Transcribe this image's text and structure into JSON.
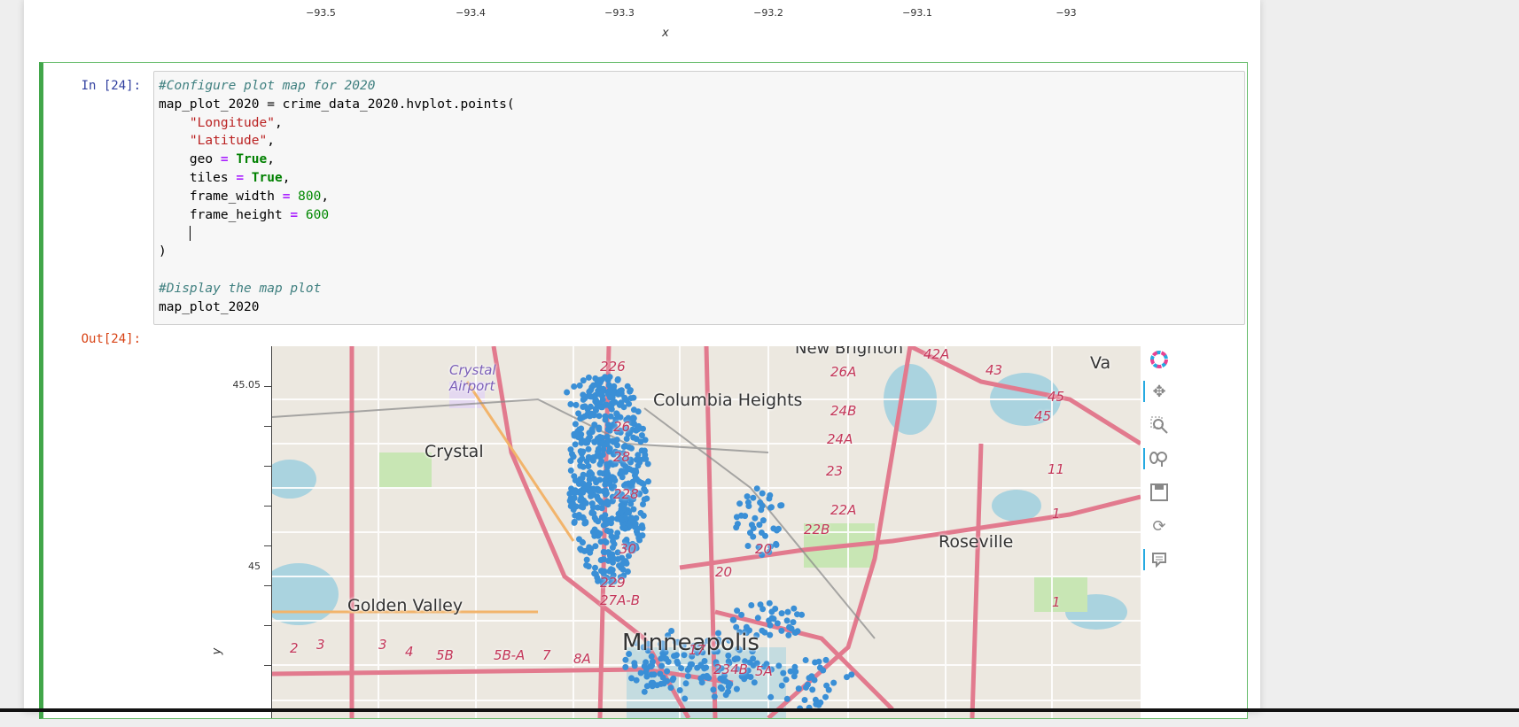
{
  "previous_output": {
    "x_ticks": [
      "−93.5",
      "−93.4",
      "−93.3",
      "−93.2",
      "−93.1",
      "−93"
    ],
    "x_label": "x"
  },
  "cell": {
    "in_prompt": "In [24]:",
    "out_prompt": "Out[24]:",
    "code_lines": {
      "l1_comment": "#Configure plot map for 2020",
      "l2_a": "map_plot_2020 = crime_data_2020.hvplot.points(",
      "l3_str": "\"Longitude\"",
      "l4_str": "\"Latitude\"",
      "l5_name": "geo",
      "l5_val": "True",
      "l6_name": "tiles",
      "l6_val": "True",
      "l7_name": "frame_width",
      "l7_val": "800",
      "l8_name": "frame_height",
      "l8_val": "600",
      "l10": ")",
      "l12_comment": "#Display the map plot",
      "l13": "map_plot_2020",
      "eq": "=",
      "comma": ","
    }
  },
  "plot": {
    "y_ticks": [
      "45.05",
      "45"
    ],
    "y_label": "y",
    "point_color": "#3a8fd6",
    "map_labels": {
      "new_brighton": "New Brighton",
      "crystal_airport": "Crystal Airport",
      "columbia_heights": "Columbia Heights",
      "crystal": "Crystal",
      "roseville": "Roseville",
      "golden_valley": "Golden Valley",
      "minneapolis": "Minneapolis",
      "va": "Va"
    },
    "road_shields": [
      "226",
      "26A",
      "42A",
      "43",
      "45",
      "45",
      "24B",
      "24A",
      "23",
      "22A",
      "22B",
      "26",
      "28",
      "228",
      "30",
      "20",
      "20",
      "229",
      "27A-B",
      "17",
      "234B",
      "5A",
      "2",
      "3",
      "3",
      "4",
      "5B",
      "5B-A",
      "7",
      "8A",
      "11",
      "1",
      "1"
    ],
    "toolbar": [
      "bokeh-logo-icon",
      "pan-icon",
      "box-zoom-icon",
      "wheel-zoom-icon",
      "save-icon",
      "reset-icon",
      "hover-icon"
    ]
  }
}
